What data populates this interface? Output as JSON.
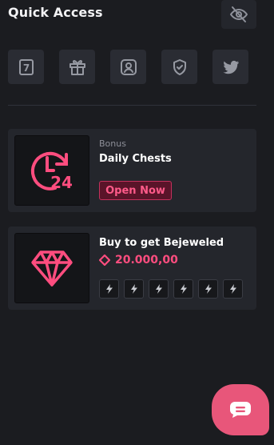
{
  "header": {
    "title": "Quick Access",
    "hide_icon": "eye-off-icon"
  },
  "quick_buttons": [
    {
      "name": "calendar-day-7",
      "icon": "calendar-seven-icon",
      "text": "7"
    },
    {
      "name": "gift",
      "icon": "gift-icon"
    },
    {
      "name": "profile",
      "icon": "user-icon"
    },
    {
      "name": "security",
      "icon": "shield-check-icon"
    },
    {
      "name": "twitter",
      "icon": "twitter-icon"
    }
  ],
  "bonus_card": {
    "kicker": "Bonus",
    "title": "Daily Chests",
    "button_label": "Open Now",
    "image_icon": "clock-24-icon",
    "image_text": "24"
  },
  "shop_card": {
    "title": "Buy to get Bejeweled",
    "price": "20.000,00",
    "currency_icon": "diamond-outline-icon",
    "image_icon": "gem-icon",
    "boost_icon": "lightning-icon",
    "boost_count": 6
  },
  "chat": {
    "icon": "chat-bubble-icon"
  },
  "colors": {
    "background": "#1b1c20",
    "card": "#24262c",
    "accent": "#ff4d7f",
    "accent_dark": "#5a1429",
    "fab": "#e8567a"
  }
}
